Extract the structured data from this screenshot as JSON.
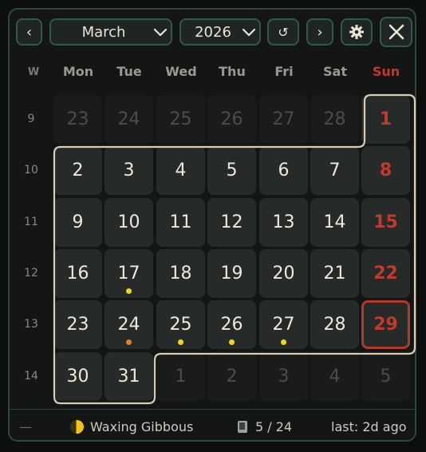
{
  "header": {
    "prev_label": "‹",
    "next_label": "›",
    "month": "March",
    "year": "2026",
    "today_icon_label": "↺"
  },
  "weekday_header": {
    "week_label": "W",
    "days": [
      "Mon",
      "Tue",
      "Wed",
      "Thu",
      "Fri",
      "Sat",
      "Sun"
    ]
  },
  "weeks": [
    {
      "number": "9",
      "days": [
        {
          "label": "23",
          "current_month": false
        },
        {
          "label": "24",
          "current_month": false
        },
        {
          "label": "25",
          "current_month": false
        },
        {
          "label": "26",
          "current_month": false
        },
        {
          "label": "27",
          "current_month": false
        },
        {
          "label": "28",
          "current_month": false
        },
        {
          "label": "1",
          "current_month": true
        }
      ]
    },
    {
      "number": "10",
      "days": [
        {
          "label": "2",
          "current_month": true
        },
        {
          "label": "3",
          "current_month": true
        },
        {
          "label": "4",
          "current_month": true
        },
        {
          "label": "5",
          "current_month": true
        },
        {
          "label": "6",
          "current_month": true
        },
        {
          "label": "7",
          "current_month": true
        },
        {
          "label": "8",
          "current_month": true
        }
      ]
    },
    {
      "number": "11",
      "days": [
        {
          "label": "9",
          "current_month": true
        },
        {
          "label": "10",
          "current_month": true
        },
        {
          "label": "11",
          "current_month": true
        },
        {
          "label": "12",
          "current_month": true
        },
        {
          "label": "13",
          "current_month": true
        },
        {
          "label": "14",
          "current_month": true
        },
        {
          "label": "15",
          "current_month": true
        }
      ]
    },
    {
      "number": "12",
      "days": [
        {
          "label": "16",
          "current_month": true
        },
        {
          "label": "17",
          "current_month": true,
          "dot": "#f2d70f"
        },
        {
          "label": "18",
          "current_month": true
        },
        {
          "label": "19",
          "current_month": true
        },
        {
          "label": "20",
          "current_month": true
        },
        {
          "label": "21",
          "current_month": true
        },
        {
          "label": "22",
          "current_month": true
        }
      ]
    },
    {
      "number": "13",
      "days": [
        {
          "label": "23",
          "current_month": true
        },
        {
          "label": "24",
          "current_month": true,
          "dot": "#e67e22"
        },
        {
          "label": "25",
          "current_month": true,
          "dot": "#f2d70f"
        },
        {
          "label": "26",
          "current_month": true,
          "dot": "#f2d70f"
        },
        {
          "label": "27",
          "current_month": true,
          "dot": "#f2d70f"
        },
        {
          "label": "28",
          "current_month": true
        },
        {
          "label": "29",
          "current_month": true,
          "today": true
        }
      ]
    },
    {
      "number": "14",
      "days": [
        {
          "label": "30",
          "current_month": true
        },
        {
          "label": "31",
          "current_month": true
        },
        {
          "label": "1",
          "current_month": false
        },
        {
          "label": "2",
          "current_month": false
        },
        {
          "label": "3",
          "current_month": false
        },
        {
          "label": "4",
          "current_month": false
        },
        {
          "label": "5",
          "current_month": false
        }
      ]
    }
  ],
  "footer": {
    "dash": "—",
    "moon_phase": "Waxing Gibbous",
    "count": "5 / 24",
    "last": "last: 2d ago"
  },
  "colors": {
    "accent_border": "#2e5a47",
    "sunday": "#c23a2c",
    "today_border": "#b3382c",
    "month_outline": "#d8ccb4"
  }
}
